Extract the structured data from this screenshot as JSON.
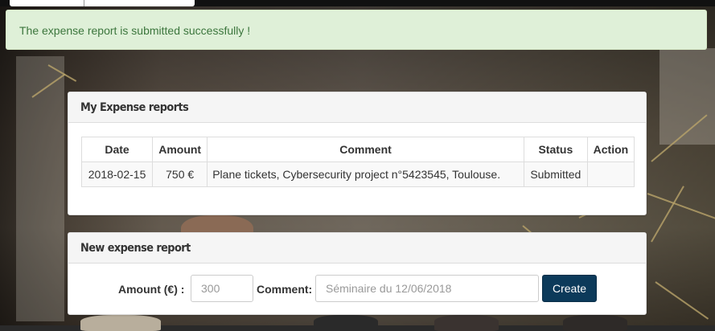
{
  "alert": {
    "message": "The expense report is submitted successfully !"
  },
  "reports_panel": {
    "title": "My Expense reports",
    "columns": [
      "Date",
      "Amount",
      "Comment",
      "Status",
      "Action"
    ],
    "rows": [
      {
        "date": "2018-02-15",
        "amount": "750 €",
        "comment": "Plane tickets, Cybersecurity project n°5423545, Toulouse.",
        "status": "Submitted",
        "action": ""
      }
    ]
  },
  "new_report_panel": {
    "title": "New expense report",
    "amount_label": "Amount (€) :",
    "amount_placeholder": "300",
    "comment_label": "Comment:",
    "comment_placeholder": "Séminaire du 12/06/2018",
    "create_label": "Create"
  },
  "colors": {
    "alert_bg": "#dff0d8",
    "alert_text": "#3c763d",
    "primary_button": "#0c3a5a"
  }
}
